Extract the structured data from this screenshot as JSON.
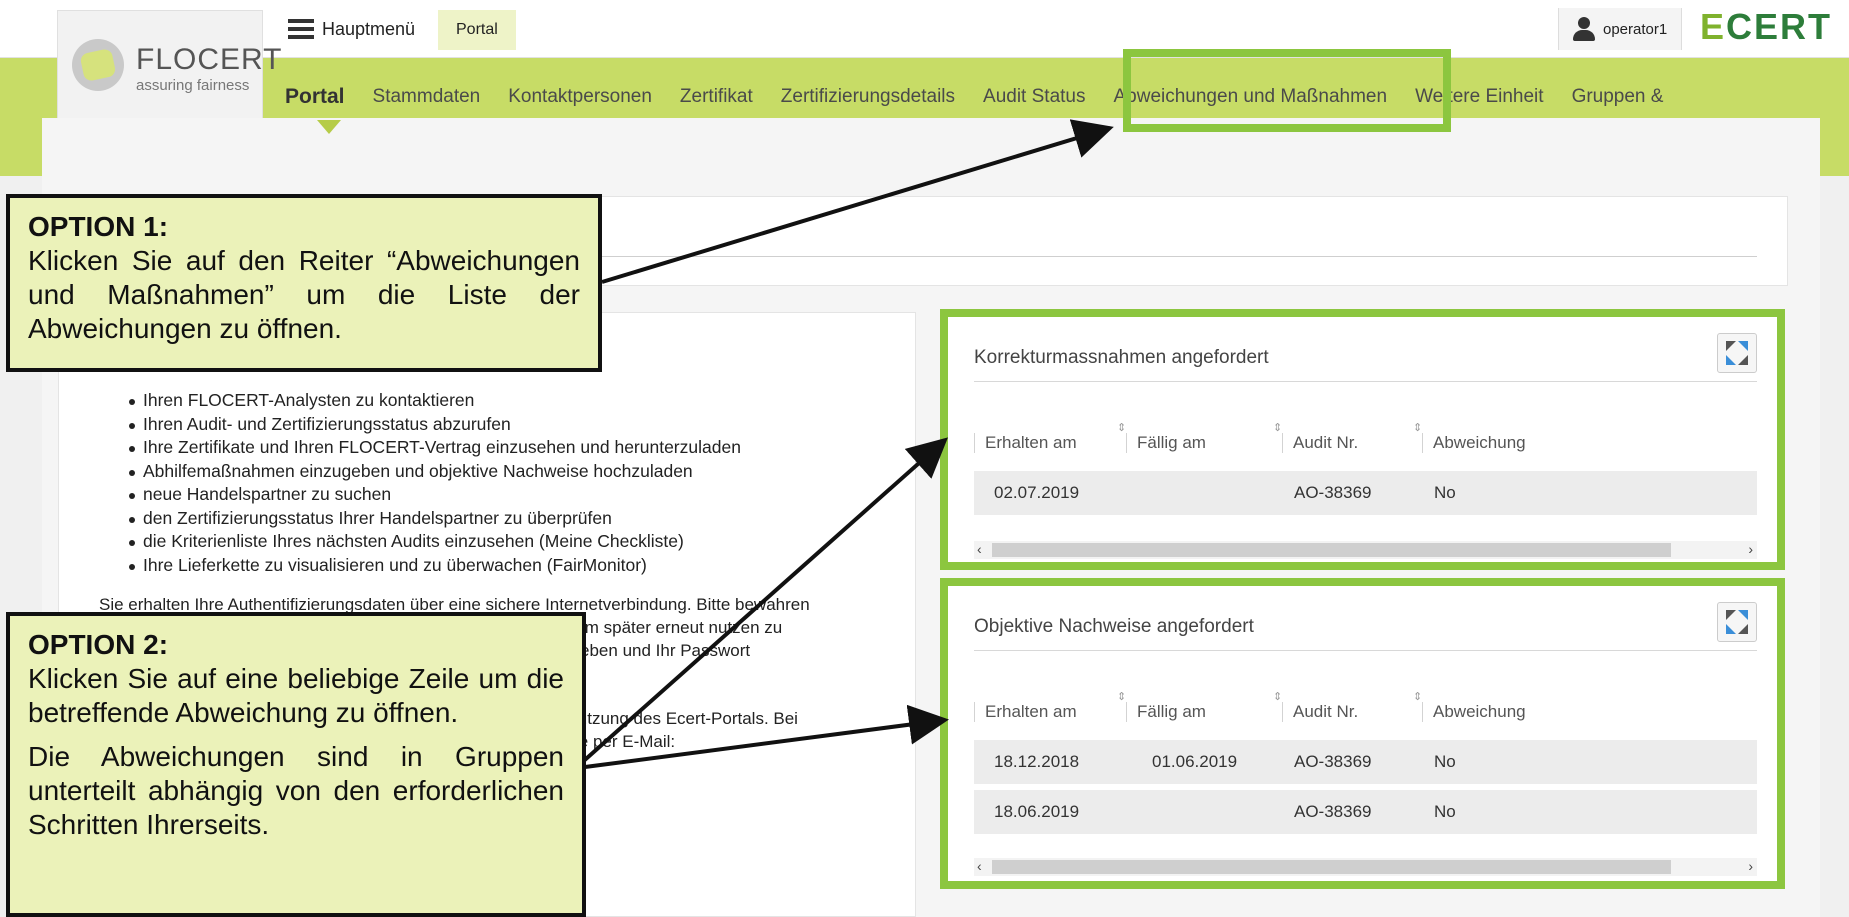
{
  "header": {
    "logo_name": "FLOCERT",
    "logo_tagline": "assuring fairness",
    "menu_label": "Hauptmenü",
    "breadcrumb": "Portal",
    "username": "operator1",
    "brand_first_letter": "E",
    "brand_rest": "CERT"
  },
  "nav": {
    "tabs": [
      {
        "label": "Portal",
        "active": true
      },
      {
        "label": "Stammdaten"
      },
      {
        "label": "Kontaktpersonen"
      },
      {
        "label": "Zertifikat"
      },
      {
        "label": "Zertifizierungsdetails"
      },
      {
        "label": "Audit Status"
      },
      {
        "label": "Abweichungen und Maßnahmen",
        "highlighted": true
      },
      {
        "label": "Weitere Einheit"
      },
      {
        "label": "Gruppen &"
      }
    ]
  },
  "info": {
    "bullets": [
      "Ihren FLOCERT-Analysten zu kontaktieren",
      "Ihren Audit- und Zertifizierungsstatus abzurufen",
      "Ihre Zertifikate und Ihren FLOCERT-Vertrag einzusehen und herunterzuladen",
      "Abhilfemaßnahmen einzugeben und objektive Nachweise hochzuladen",
      "neue Handelspartner zu suchen",
      "den Zertifizierungsstatus Ihrer Handelspartner zu überprüfen",
      "die Kriterienliste Ihres nächsten Audits einzusehen (Meine Checkliste)",
      "Ihre Lieferkette zu visualisieren und zu überwachen (FairMonitor)"
    ],
    "para1_line1": "Sie erhalten Ihre Authentifizierungsdaten über eine sichere Internetverbindung. Bitte bewahren",
    "para1_line2": "s System später erneut nutzen zu",
    "para1_line3": "iterzugeben und Ihr Passwort",
    "para2_line1": "n zur Nutzung des Ecert-Portals. Bei",
    "para2_line2": "ung bitte per E-Mail:"
  },
  "panels": {
    "corrective": {
      "title": "Korrekturmassnahmen angefordert",
      "columns": [
        "Erhalten am",
        "Fällig am",
        "Audit Nr.",
        "Abweichung"
      ],
      "rows": [
        {
          "received": "02.07.2019",
          "due": "",
          "audit": "AO-38369",
          "deviation": "No"
        }
      ]
    },
    "evidence": {
      "title": "Objektive Nachweise angefordert",
      "columns": [
        "Erhalten am",
        "Fällig am",
        "Audit Nr.",
        "Abweichung"
      ],
      "rows": [
        {
          "received": "18.12.2018",
          "due": "01.06.2019",
          "audit": "AO-38369",
          "deviation": "No"
        },
        {
          "received": "18.06.2019",
          "due": "",
          "audit": "AO-38369",
          "deviation": "No"
        }
      ]
    }
  },
  "callouts": {
    "option1": {
      "title": "OPTION 1:",
      "body": "Klicken Sie auf den Reiter “Abweichungen und Maßnahmen” um die Liste der Abweichungen zu öffnen."
    },
    "option2": {
      "title": "OPTION 2:",
      "body1": "Klicken Sie auf eine beliebige Zeile um die betreffende Abweichung zu öffnen.",
      "body2": "Die Abweichungen sind in Gruppen unterteilt abhängig von den erforderlichen Schritten Ihrerseits."
    }
  },
  "colors": {
    "header_green": "#c7dc66",
    "highlight_green": "#8cc63f",
    "callout_fill": "#ebf2b9",
    "brand_light": "#7fb22d",
    "brand_dark": "#2d7d3a"
  },
  "icons": {
    "menu": "hamburger-icon",
    "user": "user-icon",
    "expand": "expand-icon",
    "sort": "sort-icon"
  }
}
